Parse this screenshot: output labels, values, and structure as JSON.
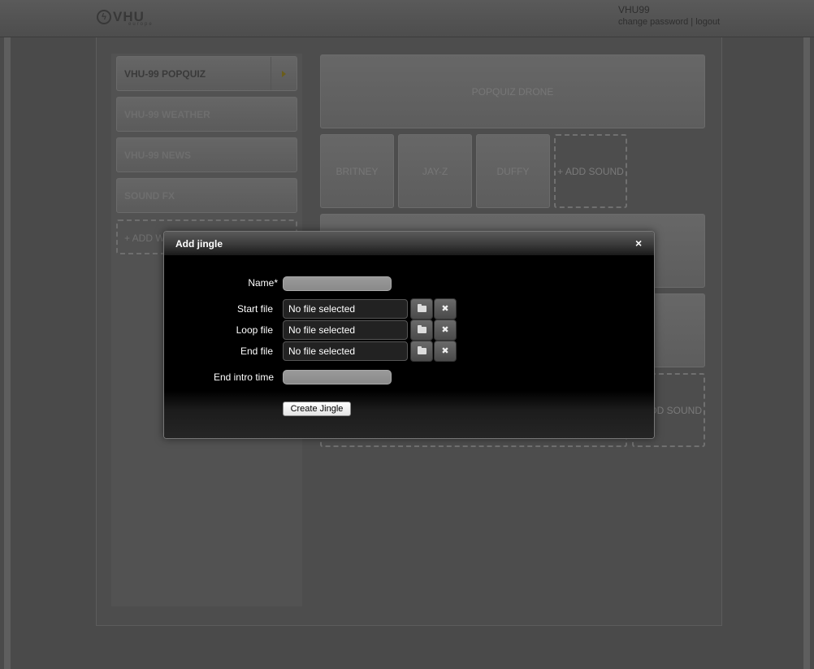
{
  "header": {
    "logo_text": "VHU",
    "logo_sub": "europe",
    "username": "VHU99",
    "change_password": "change password",
    "separator": "|",
    "logout": "logout"
  },
  "sidebar": {
    "items": [
      {
        "label": "VHU-99 POPQUIZ"
      },
      {
        "label": "VHU-99 WEATHER"
      },
      {
        "label": "VHU-99 NEWS"
      },
      {
        "label": "SOUND FX"
      }
    ],
    "add_label": "+ ADD W"
  },
  "main": {
    "drone_label": "POPQUIZ DRONE",
    "sounds": [
      "BRITNEY",
      "JAY-Z",
      "DUFFY"
    ],
    "add_sound": "+ ADD SOUND",
    "add_sound_partial": "DD SOUND"
  },
  "modal": {
    "title": "Add jingle",
    "close_icon": "×",
    "name_label": "Name*",
    "start_label": "Start file",
    "loop_label": "Loop file",
    "end_label": "End file",
    "end_intro_label": "End intro time",
    "no_file": "No file selected",
    "create_button": "Create Jingle",
    "remove_icon": "✖"
  }
}
